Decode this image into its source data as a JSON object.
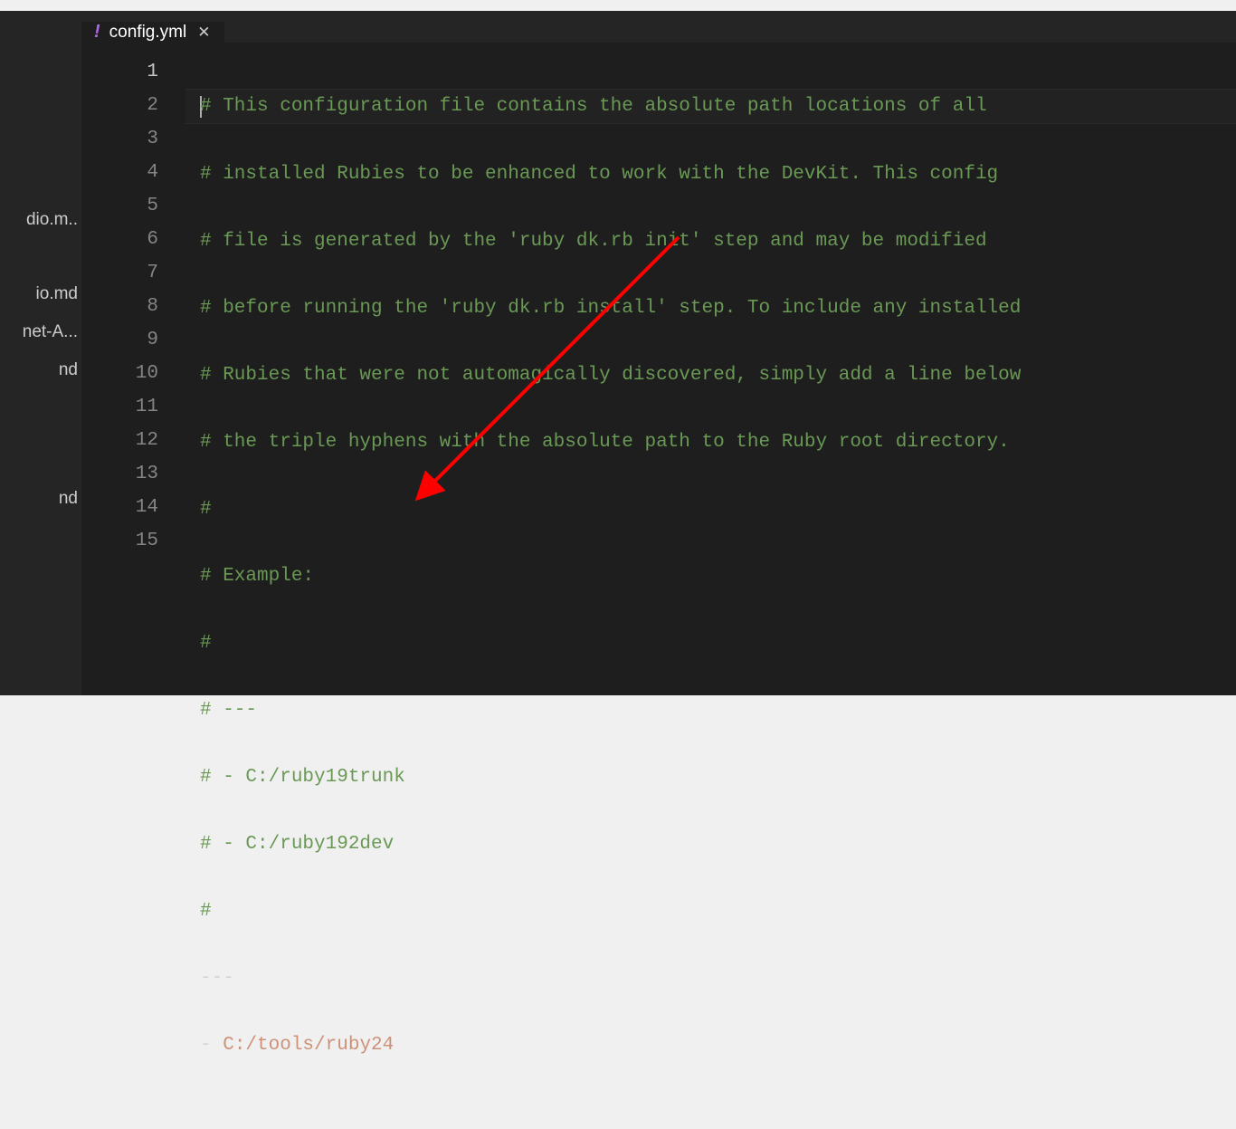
{
  "sidebar": {
    "items": [
      {
        "label": "dio.m.."
      },
      {
        "label": "io.md"
      },
      {
        "label": "net-A..."
      },
      {
        "label": "nd"
      },
      {
        "label": "nd"
      }
    ]
  },
  "tab": {
    "filename": "config.yml",
    "close_symbol": "✕",
    "file_icon": "!"
  },
  "code": {
    "lines": [
      {
        "n": "1",
        "type": "comment",
        "text": "# This configuration file contains the absolute path locations of all"
      },
      {
        "n": "2",
        "type": "comment",
        "text": "# installed Rubies to be enhanced to work with the DevKit. This config"
      },
      {
        "n": "3",
        "type": "comment",
        "text": "# file is generated by the 'ruby dk.rb init' step and may be modified"
      },
      {
        "n": "4",
        "type": "comment",
        "text": "# before running the 'ruby dk.rb install' step. To include any installed"
      },
      {
        "n": "5",
        "type": "comment",
        "text": "# Rubies that were not automagically discovered, simply add a line below"
      },
      {
        "n": "6",
        "type": "comment",
        "text": "# the triple hyphens with the absolute path to the Ruby root directory."
      },
      {
        "n": "7",
        "type": "comment",
        "text": "#"
      },
      {
        "n": "8",
        "type": "comment",
        "text": "# Example:"
      },
      {
        "n": "9",
        "type": "comment",
        "text": "#"
      },
      {
        "n": "10",
        "type": "comment",
        "text": "# ---"
      },
      {
        "n": "11",
        "type": "comment",
        "text": "# - C:/ruby19trunk"
      },
      {
        "n": "12",
        "type": "comment",
        "text": "# - C:/ruby192dev"
      },
      {
        "n": "13",
        "type": "comment",
        "text": "#"
      },
      {
        "n": "14",
        "type": "plain",
        "text": "---"
      },
      {
        "n": "15",
        "type": "yaml",
        "dash": "- ",
        "value": "C:/tools/ruby24"
      }
    ]
  },
  "annotation": {
    "color": "#ff0000"
  }
}
